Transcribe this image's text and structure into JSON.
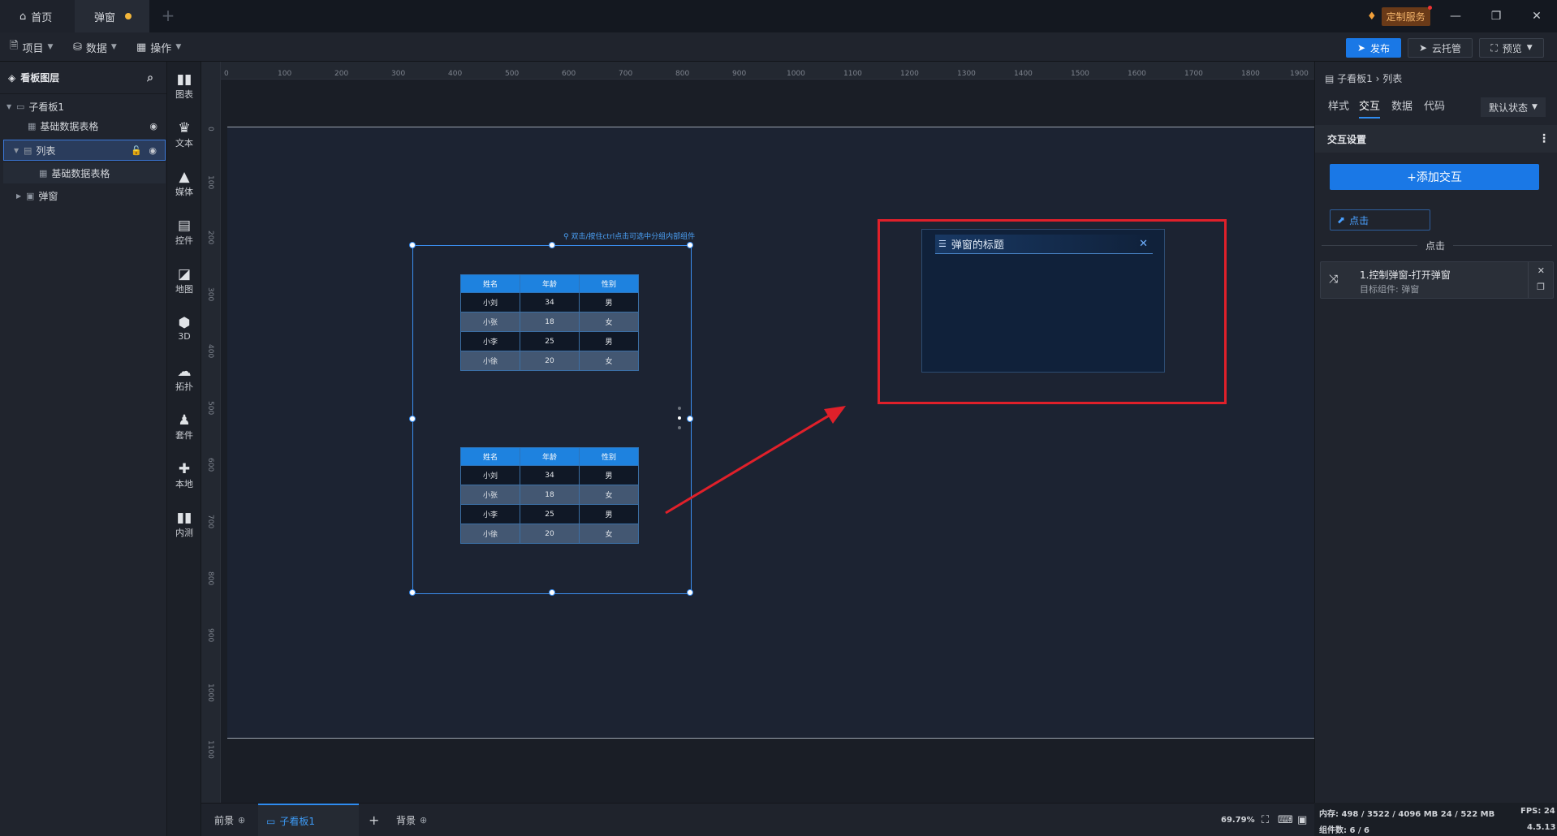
{
  "titlebar": {
    "tabs": [
      {
        "label": "首页",
        "icon": "home-icon"
      },
      {
        "label": "弹窗",
        "icon": "unsaved-dot"
      }
    ],
    "add_tab": "+",
    "custom_service": "定制服务",
    "window_controls": {
      "minimize": "—",
      "restore": "❐",
      "close": "✕"
    }
  },
  "menubar": {
    "items": [
      {
        "label": "项目",
        "icon": "document-icon"
      },
      {
        "label": "数据",
        "icon": "database-icon"
      },
      {
        "label": "操作",
        "icon": "grid-icon"
      }
    ],
    "publish": "发布",
    "cloud": "云托管",
    "preview": "预览"
  },
  "layers": {
    "title": "看板图层",
    "items": [
      {
        "label": "子看板1"
      },
      {
        "label": "基础数据表格"
      },
      {
        "label": "列表"
      },
      {
        "label": "基础数据表格"
      },
      {
        "label": "弹窗"
      }
    ]
  },
  "tools": [
    {
      "label": "图表",
      "icon": "chart-icon"
    },
    {
      "label": "文本",
      "icon": "text-icon"
    },
    {
      "label": "媒体",
      "icon": "media-icon"
    },
    {
      "label": "控件",
      "icon": "widget-icon"
    },
    {
      "label": "地图",
      "icon": "map-icon"
    },
    {
      "label": "3D",
      "icon": "cube-icon"
    },
    {
      "label": "拓扑",
      "icon": "topology-icon"
    },
    {
      "label": "套件",
      "icon": "kit-icon"
    },
    {
      "label": "本地",
      "icon": "puzzle-icon"
    },
    {
      "label": "内测",
      "icon": "beta-chart-icon"
    }
  ],
  "ruler": {
    "top": [
      "0",
      "100",
      "200",
      "300",
      "400",
      "500",
      "600",
      "700",
      "800",
      "900",
      "1000",
      "1100",
      "1200",
      "1300",
      "1400",
      "1500",
      "1600",
      "1700",
      "1800",
      "1900"
    ],
    "left": [
      "0",
      "100",
      "200",
      "300",
      "400",
      "500",
      "600",
      "700",
      "800",
      "900",
      "1000",
      "1100"
    ]
  },
  "canvas": {
    "hint": "双击/按住ctrl点击可选中分组内部组件",
    "table_headers": [
      "姓名",
      "年龄",
      "性别"
    ],
    "table_rows": [
      [
        "小刘",
        "34",
        "男"
      ],
      [
        "小张",
        "18",
        "女"
      ],
      [
        "小李",
        "25",
        "男"
      ],
      [
        "小徐",
        "20",
        "女"
      ]
    ],
    "popup_title": "弹窗的标题",
    "arrow_color": "#e0202a",
    "highlight_color": "#e0202a"
  },
  "right_panel": {
    "breadcrumb": "子看板1 › 列表",
    "tabs": [
      "样式",
      "交互",
      "数据",
      "代码"
    ],
    "active_tab": "交互",
    "state": "默认状态",
    "section": "交互设置",
    "add_button": "+添加交互",
    "trigger": "点击",
    "divider_label": "点击",
    "action": {
      "title": "1.控制弹窗-打开弹窗",
      "subtitle": "目标组件: 弹窗"
    }
  },
  "bottom": {
    "tabs": [
      "前景",
      "子看板1",
      "背景"
    ],
    "zoom": "69.79%"
  },
  "status": {
    "memory": "内存: 498 / 3522 / 4096 MB  24 / 522 MB",
    "fps": "FPS: 24",
    "components": "组件数: 6 / 6",
    "version": "4.5.13"
  }
}
